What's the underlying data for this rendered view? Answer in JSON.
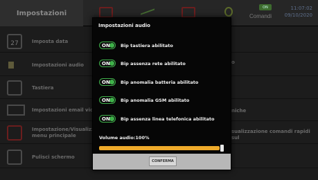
{
  "header": {
    "title": "Impostazioni",
    "comandi_badge": "ON",
    "comandi_label": "Comandi",
    "time": "11:07:02",
    "date": "09/10/2020"
  },
  "menu": {
    "items": [
      {
        "label": "Imposta data",
        "icon": "calendar-icon",
        "icon_text": "27"
      },
      {
        "label": "Impostazioni audio",
        "icon": "speaker-icon"
      },
      {
        "label": "Tastiera",
        "icon": "keypad-icon"
      },
      {
        "label": "Impostazioni email video",
        "icon": "mail-icon"
      },
      {
        "label": "Impostazione/Visualizzazione menu principale",
        "icon": "home-icon",
        "line1": "Impostazione/Visualizza",
        "line2": "menu principale"
      },
      {
        "label": "Pulisci schermo",
        "icon": "screen-icon"
      }
    ],
    "right_items": [
      "o",
      "niche",
      "sualizzazione comandi rapidi sul"
    ]
  },
  "dialog": {
    "title": "Impostazioni audio",
    "toggle_label": "ON",
    "options": [
      {
        "label": "Bip tastiera abilitato",
        "state": "on"
      },
      {
        "label": "Bip assenza rete abilitato",
        "state": "on"
      },
      {
        "label": "Bip anomalia batteria abilitato",
        "state": "on"
      },
      {
        "label": "Bip anomalia GSM abilitato",
        "state": "on"
      },
      {
        "label": "Bip assenza linea telefonica abilitato",
        "state": "on"
      }
    ],
    "volume_label": "Volume audio:100%",
    "volume_fraction": 1.0,
    "confirm_label": "CONFERMA"
  },
  "colors": {
    "accent_green": "#3fb24a",
    "slider_orange": "#eeaa2a",
    "clock_blue": "#5e6f8c"
  }
}
